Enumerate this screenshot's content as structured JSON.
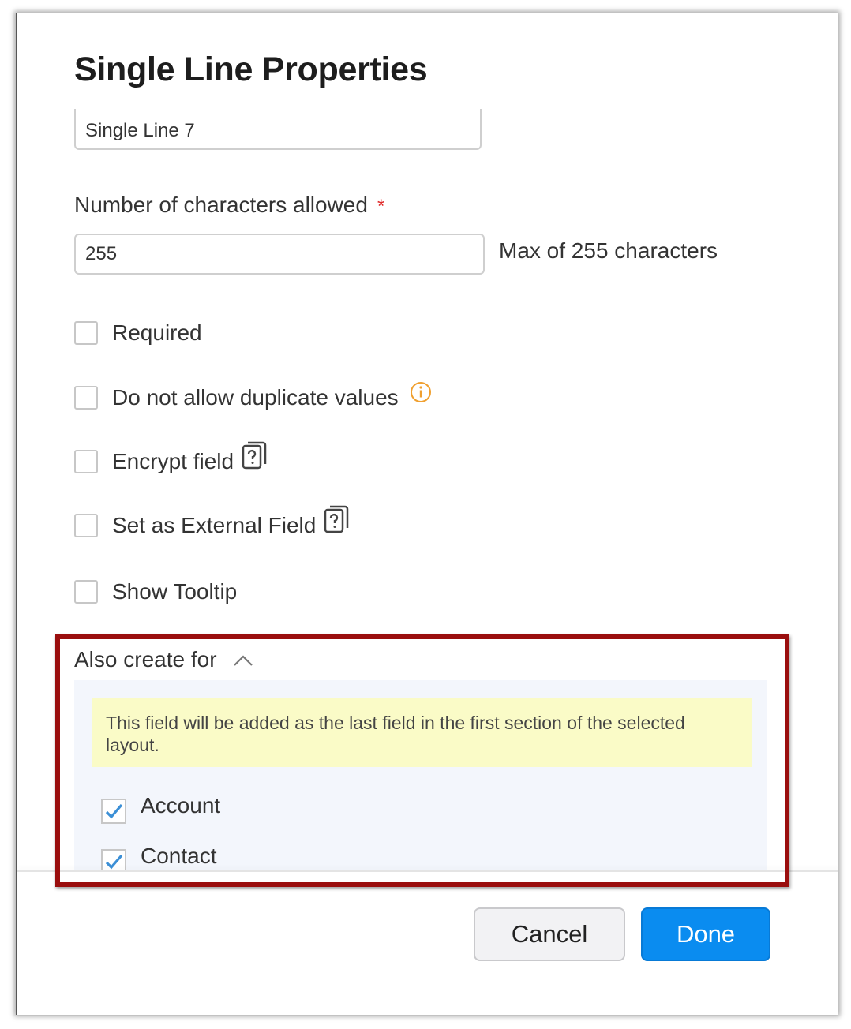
{
  "dialog": {
    "title": "Single Line Properties",
    "field_name_value": "Single Line 7",
    "chars_label": "Number of characters allowed",
    "required_star": "*",
    "chars_value": "255",
    "chars_hint": "Max of 255 characters"
  },
  "options": [
    {
      "label": "Required",
      "checked": false
    },
    {
      "label": "Do not allow duplicate values",
      "checked": false,
      "icon": "info-icon"
    },
    {
      "label": "Encrypt field",
      "checked": false,
      "icon": "help-document-icon"
    },
    {
      "label": "Set as External Field",
      "checked": false,
      "icon": "help-document-icon"
    },
    {
      "label": "Show Tooltip",
      "checked": false
    }
  ],
  "also_create": {
    "label": "Also create for",
    "expanded": true,
    "note": "This field will be added as the last field in the first section of the selected layout.",
    "modules": [
      {
        "label": "Account",
        "checked": true
      },
      {
        "label": "Contact",
        "checked": true
      }
    ]
  },
  "footer": {
    "cancel_label": "Cancel",
    "done_label": "Done"
  },
  "colors": {
    "primary": "#0a8cf0",
    "required_star": "#e02a2a",
    "info_icon": "#f0a030",
    "note_bg": "#fafbc7",
    "panel_bg": "#f3f6fc",
    "highlight_border": "#9a0e0e",
    "check_mark": "#3b8fd6"
  }
}
